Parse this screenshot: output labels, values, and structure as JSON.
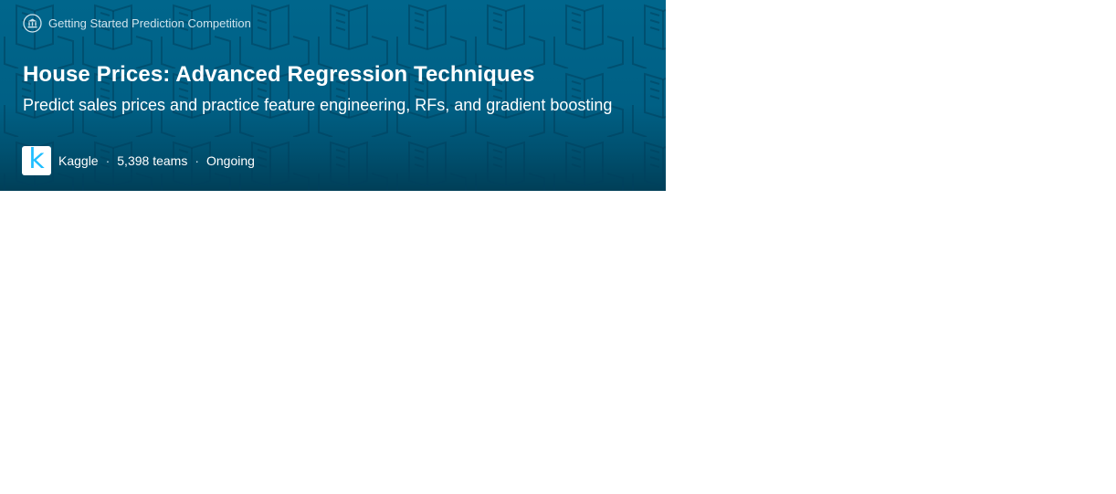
{
  "competition": {
    "category": "Getting Started Prediction Competition",
    "category_icon": "institution-icon",
    "title": "House Prices: Advanced Regression Techniques",
    "subtitle": "Predict sales prices and practice feature engineering, RFs, and gradient boosting",
    "host": "Kaggle",
    "host_logo_letter": "k",
    "teams": "5,398 teams",
    "status": "Ongoing",
    "separator": "·"
  },
  "colors": {
    "banner_top": "#00668c",
    "banner_bottom": "#003f58",
    "kaggle_blue": "#20beff"
  }
}
